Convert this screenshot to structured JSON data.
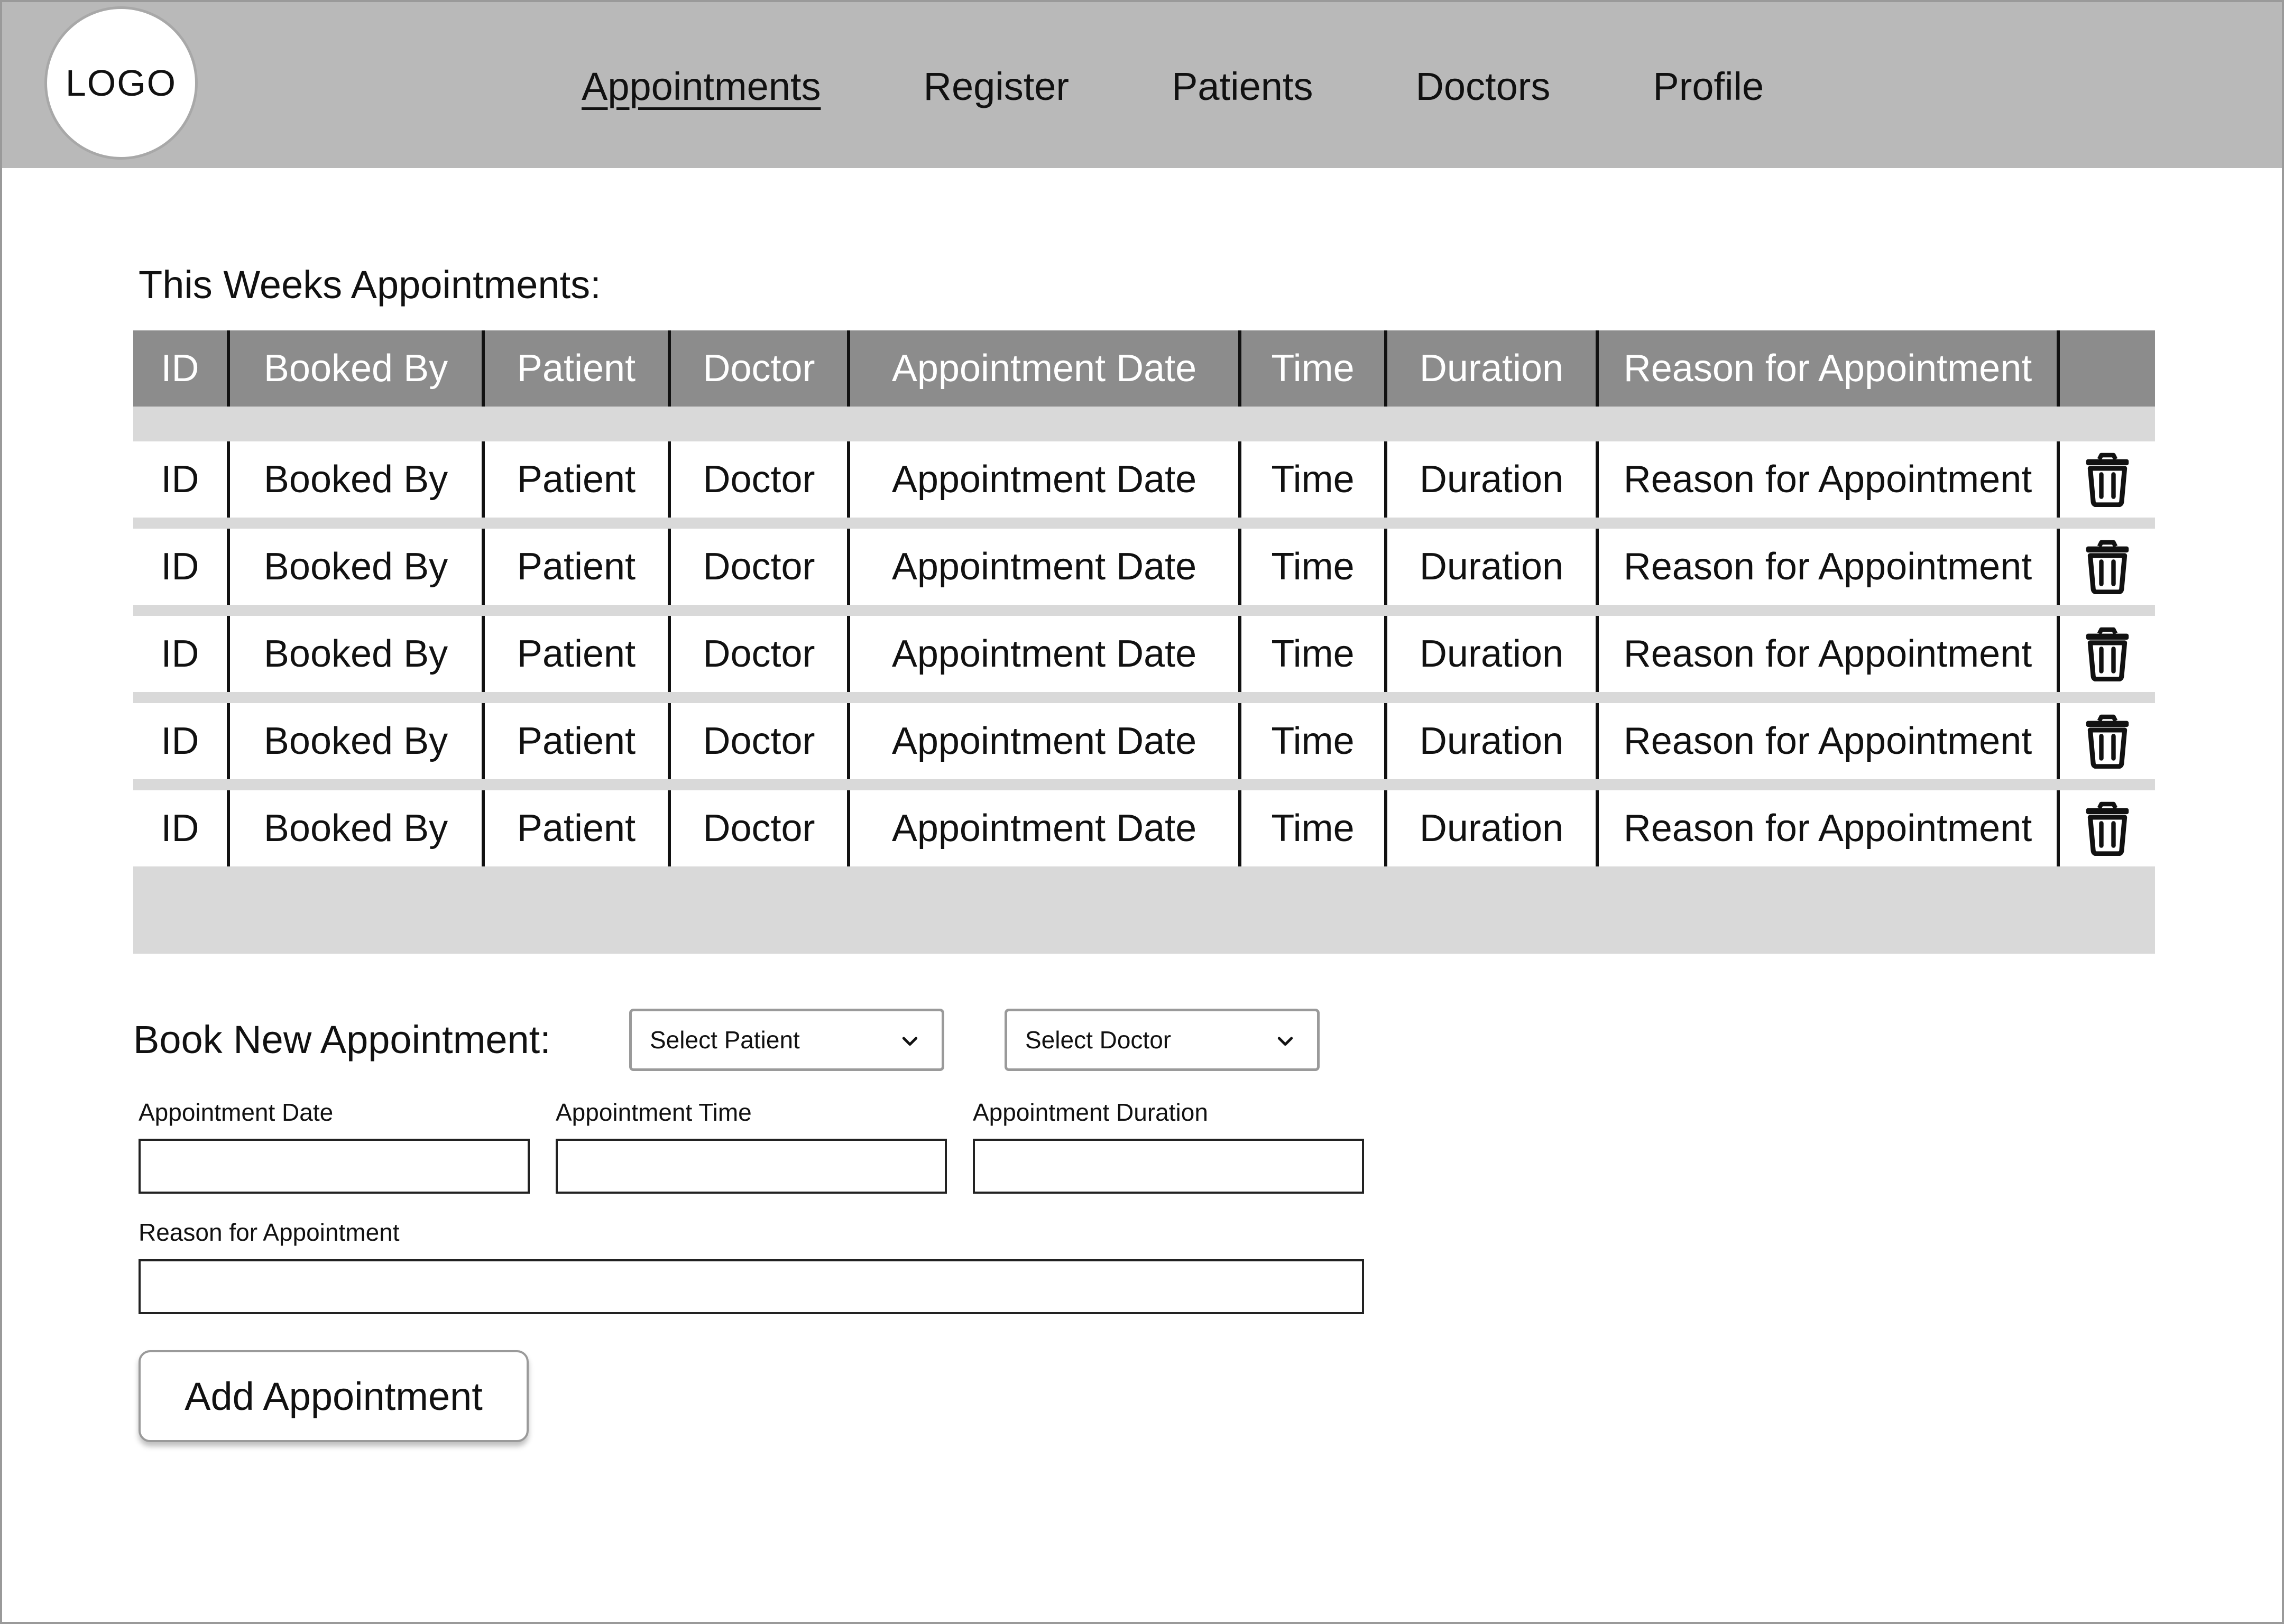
{
  "header": {
    "logo_text": "LOGO",
    "nav": [
      {
        "label": "Appointments",
        "active": true
      },
      {
        "label": "Register",
        "active": false
      },
      {
        "label": "Patients",
        "active": false
      },
      {
        "label": "Doctors",
        "active": false
      },
      {
        "label": "Profile",
        "active": false
      }
    ]
  },
  "appointments": {
    "title": "This Weeks Appointments:",
    "columns": [
      "ID",
      "Booked By",
      "Patient",
      "Doctor",
      "Appointment Date",
      "Time",
      "Duration",
      "Reason for Appointment"
    ],
    "rows": [
      [
        "ID",
        "Booked By",
        "Patient",
        "Doctor",
        "Appointment Date",
        "Time",
        "Duration",
        "Reason for Appointment"
      ],
      [
        "ID",
        "Booked By",
        "Patient",
        "Doctor",
        "Appointment Date",
        "Time",
        "Duration",
        "Reason for Appointment"
      ],
      [
        "ID",
        "Booked By",
        "Patient",
        "Doctor",
        "Appointment Date",
        "Time",
        "Duration",
        "Reason for Appointment"
      ],
      [
        "ID",
        "Booked By",
        "Patient",
        "Doctor",
        "Appointment Date",
        "Time",
        "Duration",
        "Reason for Appointment"
      ],
      [
        "ID",
        "Booked By",
        "Patient",
        "Doctor",
        "Appointment Date",
        "Time",
        "Duration",
        "Reason for Appointment"
      ]
    ],
    "row_action_icon": "trash-icon"
  },
  "booking": {
    "title": "Book New Appointment:",
    "select_patient": "Select Patient",
    "select_doctor": "Select Doctor",
    "date_label": "Appointment Date",
    "time_label": "Appointment Time",
    "duration_label": "Appointment Duration",
    "reason_label": "Reason for Appointment",
    "date_value": "",
    "time_value": "",
    "duration_value": "",
    "reason_value": "",
    "submit_label": "Add Appointment"
  },
  "colors": {
    "header_bg": "#b9b9b9",
    "table_header_bg": "#8c8c8c",
    "table_band": "#d9d9d9"
  }
}
